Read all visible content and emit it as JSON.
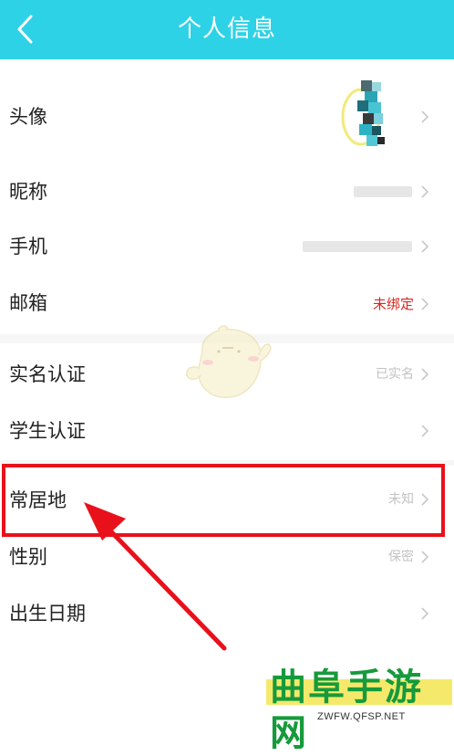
{
  "header": {
    "title": "个人信息",
    "back_icon": "chevron-left-icon",
    "background_color": "#2ed2e6"
  },
  "rows": [
    {
      "label": "头像",
      "value": "",
      "name": "avatar"
    },
    {
      "label": "昵称",
      "value": "",
      "name": "nickname"
    },
    {
      "label": "手机",
      "value": "",
      "name": "phone"
    },
    {
      "label": "邮箱",
      "value": "未绑定",
      "name": "email"
    },
    {
      "label": "实名认证",
      "value": "已实名",
      "name": "real-name-verification"
    },
    {
      "label": "学生认证",
      "value": "",
      "name": "student-verification"
    },
    {
      "label": "常居地",
      "value": "未知",
      "name": "residence"
    },
    {
      "label": "性别",
      "value": "保密",
      "name": "gender"
    },
    {
      "label": "出生日期",
      "value": "",
      "name": "birth-date"
    }
  ],
  "annotation": {
    "highlight_color": "#e8111b",
    "highlighted_row": "常居地"
  },
  "watermark": {
    "brand": "曲阜手游网",
    "url": "ZWFW.QFSP.NET"
  }
}
